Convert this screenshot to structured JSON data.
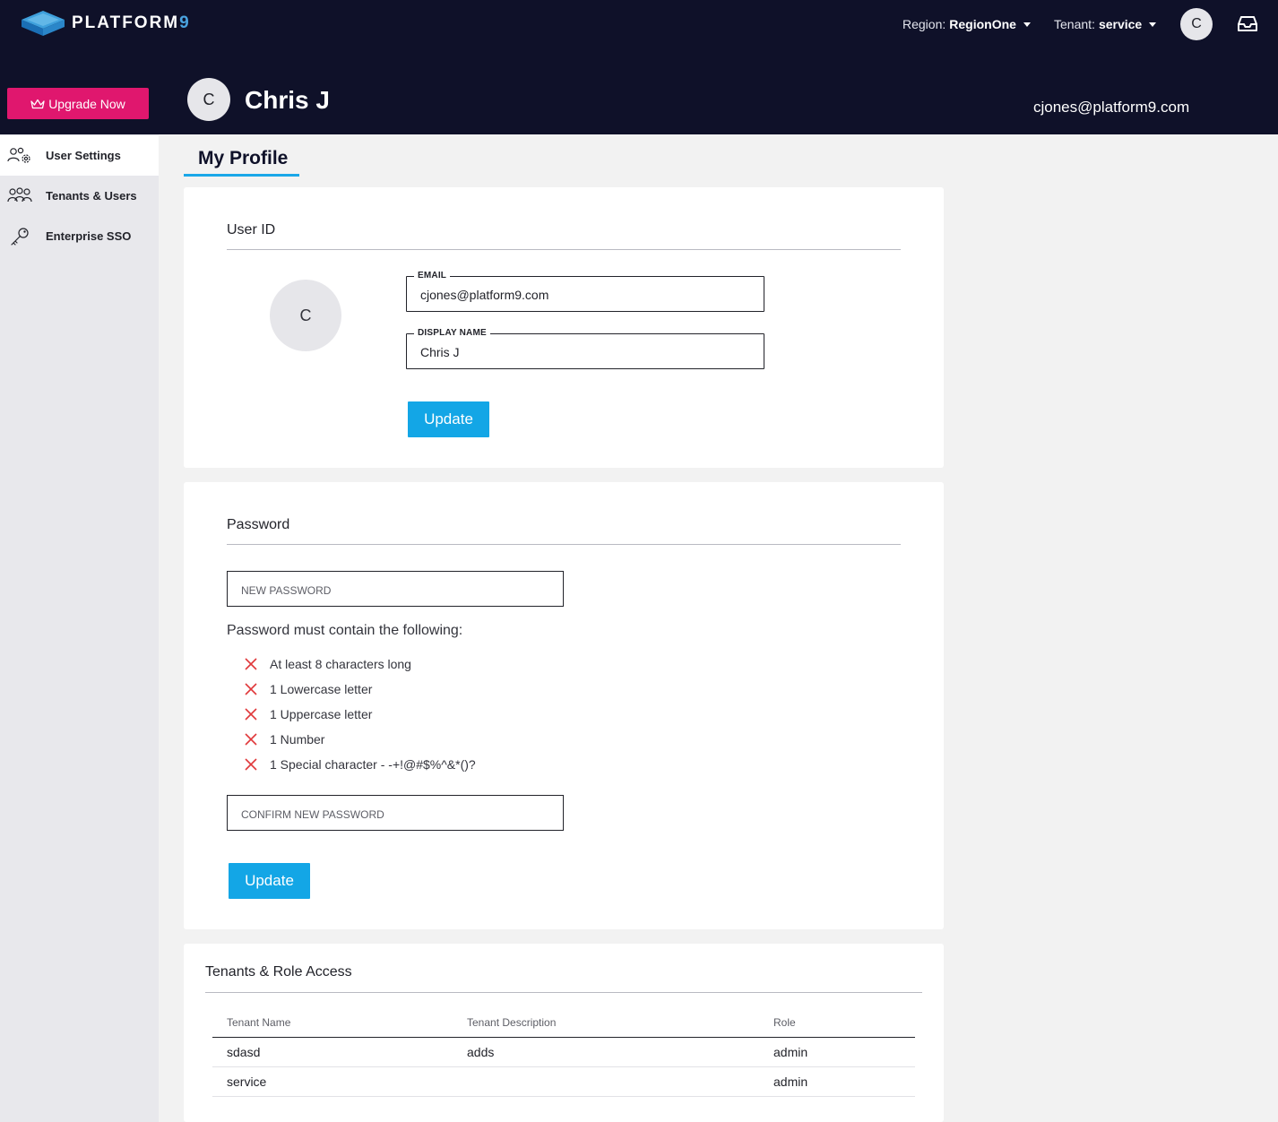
{
  "header": {
    "brand": "PLATFORM",
    "brand_suffix": "9",
    "region_label": "Region:",
    "region_value": "RegionOne",
    "tenant_label": "Tenant:",
    "tenant_value": "service",
    "avatar_initial": "C",
    "upgrade_label": "Upgrade Now",
    "user_initial": "C",
    "user_name": "Chris J",
    "user_email": "cjones@platform9.com"
  },
  "sidebar": {
    "items": [
      {
        "label": "User Settings",
        "icon": "users-gear-icon",
        "active": true
      },
      {
        "label": "Tenants & Users",
        "icon": "people-group-icon",
        "active": false
      },
      {
        "label": "Enterprise SSO",
        "icon": "key-icon",
        "active": false
      }
    ]
  },
  "main": {
    "tab_label": "My Profile",
    "user_id": {
      "title": "User ID",
      "avatar_initial": "C",
      "email_label": "EMAIL",
      "email_value": "cjones@platform9.com",
      "display_name_label": "DISPLAY NAME",
      "display_name_value": "Chris J",
      "update_label": "Update"
    },
    "password": {
      "title": "Password",
      "new_password_placeholder": "NEW PASSWORD",
      "requirements_heading": "Password must contain the following:",
      "requirements": [
        "At least 8 characters long",
        "1 Lowercase letter",
        "1 Uppercase letter",
        "1 Number",
        "1 Special character - -+!@#$%^&*()?"
      ],
      "confirm_password_placeholder": "CONFIRM NEW PASSWORD",
      "update_label": "Update"
    },
    "tenants": {
      "title": "Tenants & Role Access",
      "columns": [
        "Tenant Name",
        "Tenant Description",
        "Role"
      ],
      "rows": [
        [
          "sdasd",
          "adds",
          "admin"
        ],
        [
          "service",
          "",
          "admin"
        ]
      ]
    }
  },
  "colors": {
    "header_bg": "#0f1129",
    "upgrade_bg": "#e0176e",
    "primary": "#13a6e6",
    "error": "#e0393b"
  }
}
